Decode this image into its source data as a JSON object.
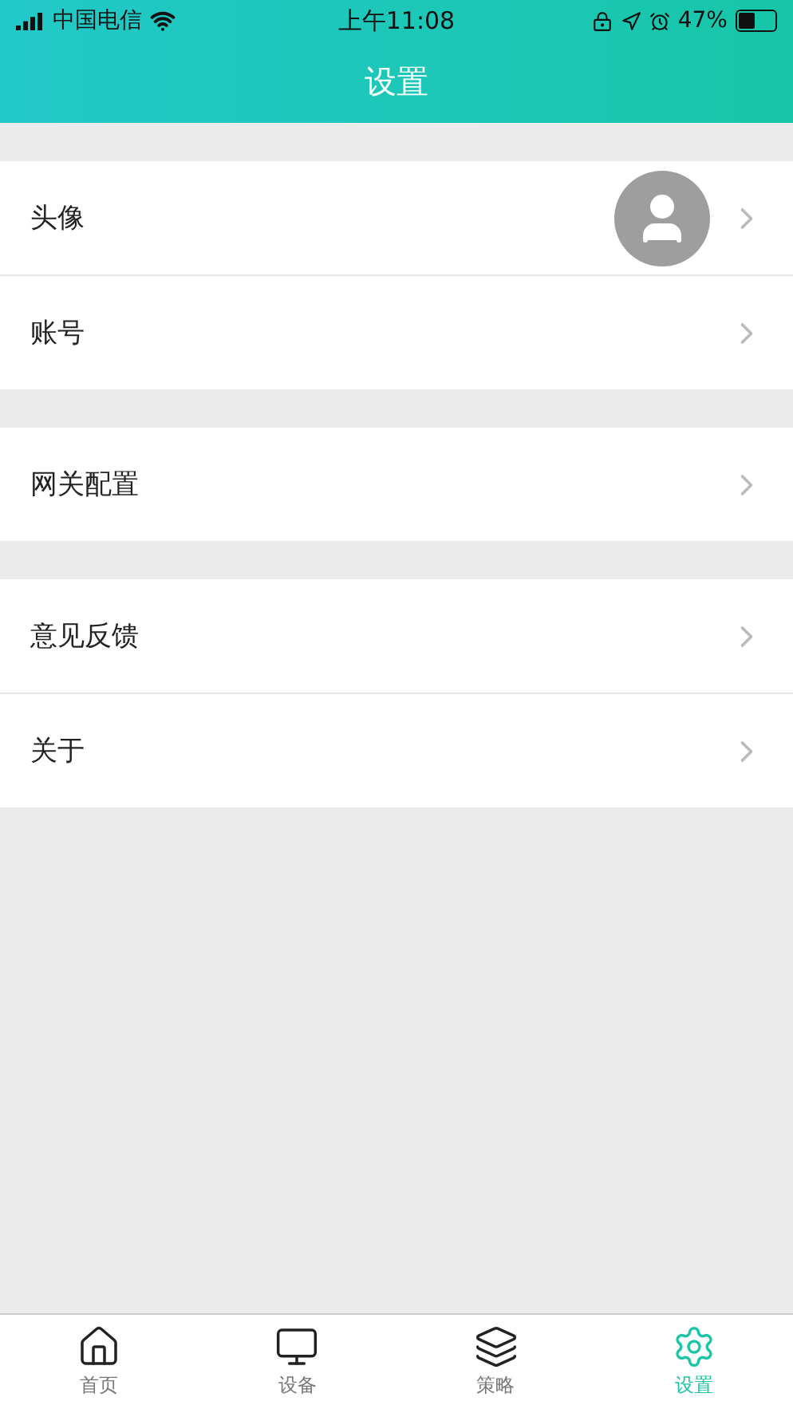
{
  "status_bar": {
    "carrier": "中国电信",
    "time": "上午11:08",
    "battery": "47%"
  },
  "header": {
    "title": "设置"
  },
  "groups": [
    {
      "items": [
        {
          "label": "头像",
          "kind": "avatar"
        },
        {
          "label": "账号",
          "kind": "plain"
        }
      ]
    },
    {
      "items": [
        {
          "label": "网关配置",
          "kind": "plain"
        }
      ]
    },
    {
      "items": [
        {
          "label": "意见反馈",
          "kind": "plain"
        },
        {
          "label": "关于",
          "kind": "plain"
        }
      ]
    }
  ],
  "tab_bar": [
    {
      "label": "首页",
      "kind": "home",
      "selected": false
    },
    {
      "label": "设备",
      "kind": "device",
      "selected": false
    },
    {
      "label": "策略",
      "kind": "layers",
      "selected": false
    },
    {
      "label": "设置",
      "kind": "settings",
      "selected": true
    }
  ]
}
